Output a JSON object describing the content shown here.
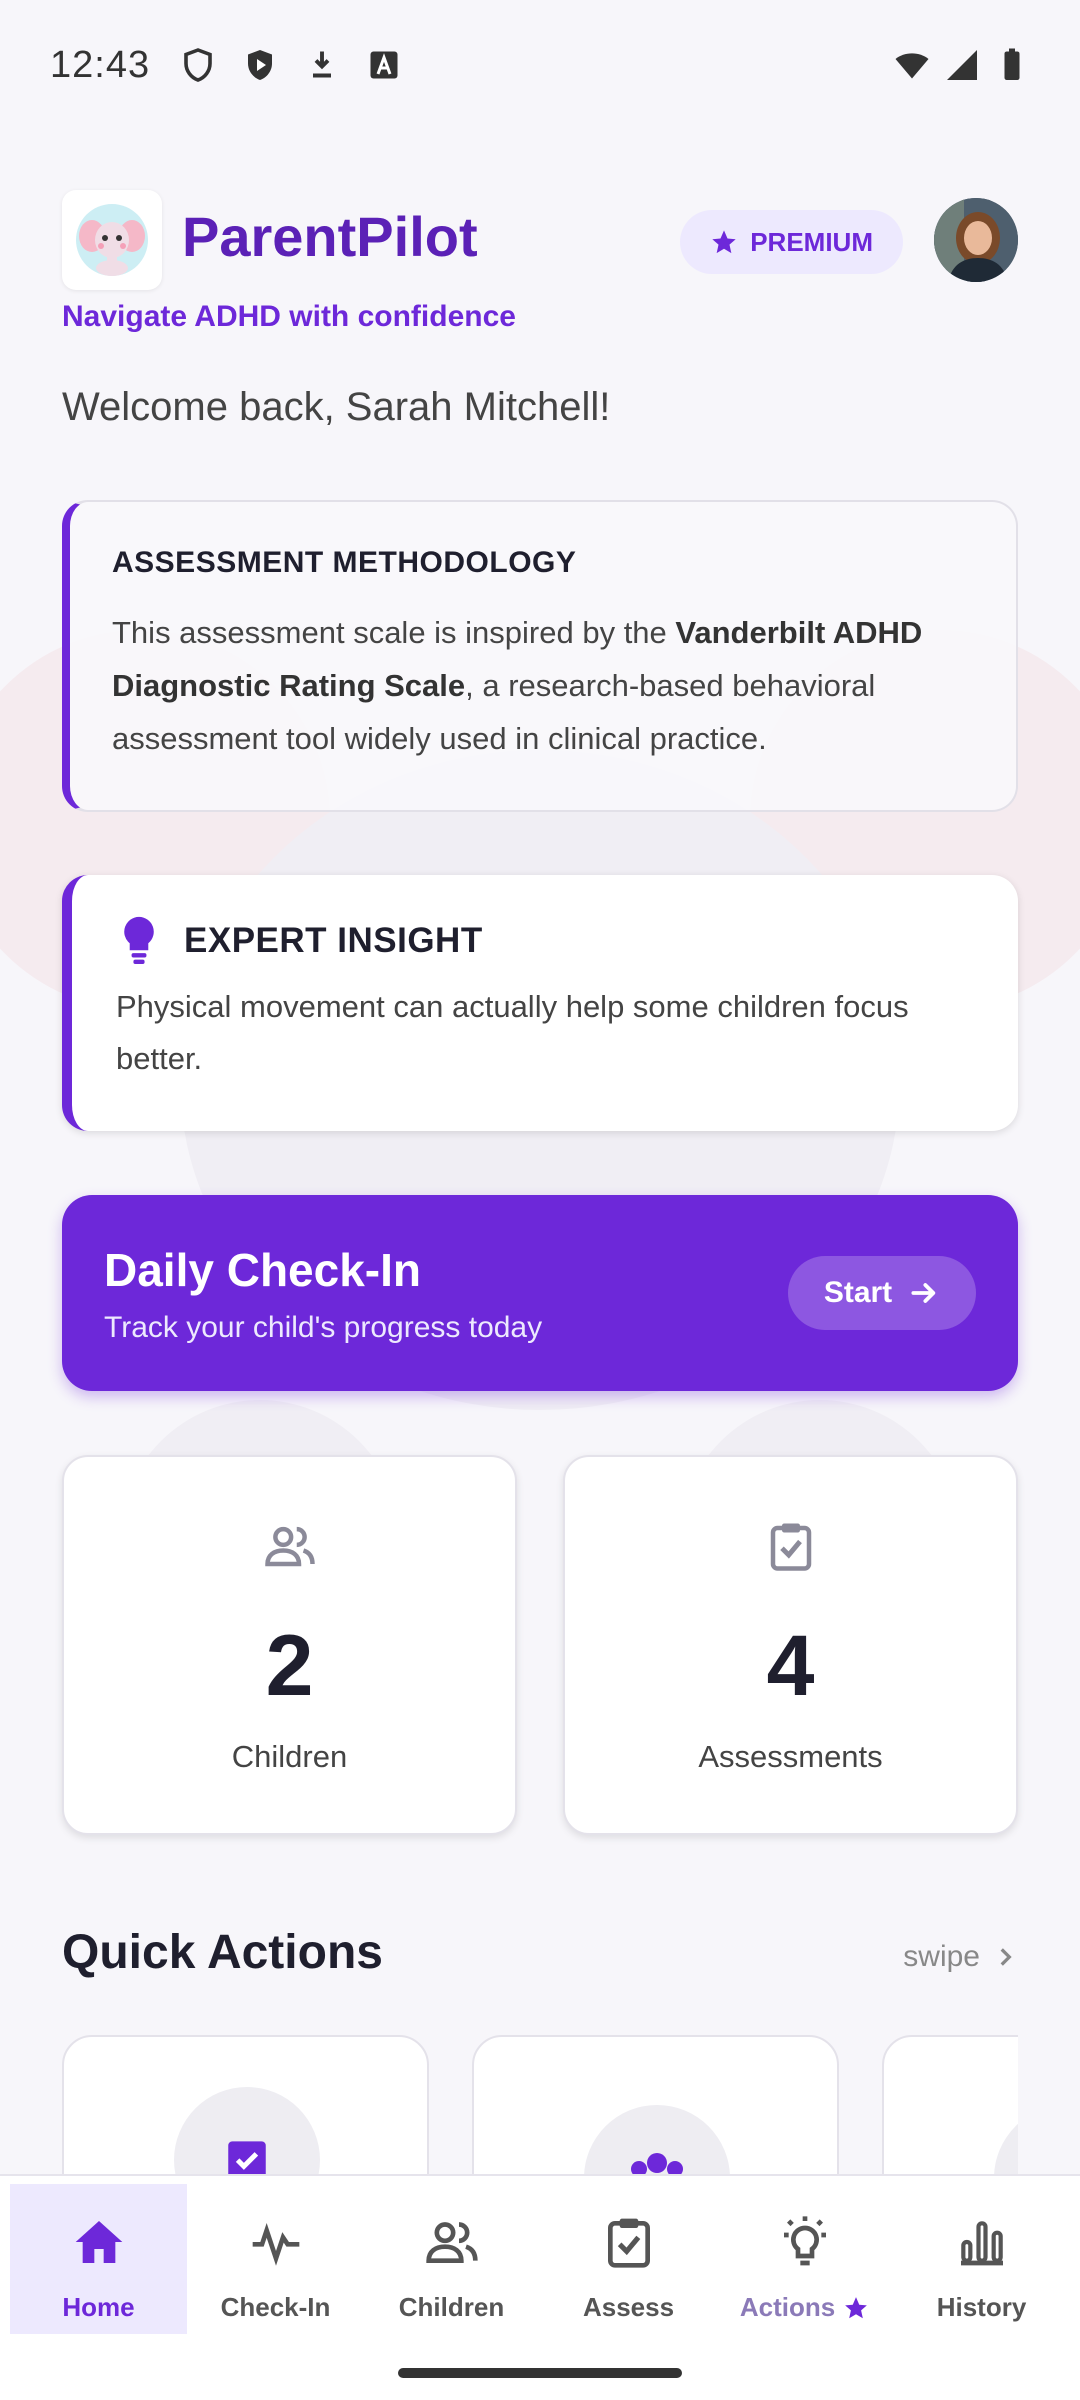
{
  "status_bar": {
    "time": "12:43"
  },
  "header": {
    "app_name": "ParentPilot",
    "tagline": "Navigate ADHD with confidence",
    "premium_label": "PREMIUM"
  },
  "welcome": "Welcome back, Sarah Mitchell!",
  "methodology": {
    "title": "ASSESSMENT METHODOLOGY",
    "text_before": "This assessment scale is inspired by the ",
    "text_bold": "Vanderbilt ADHD Diagnostic Rating Scale",
    "text_after": ", a research-based behavioral assessment tool widely used in clinical practice."
  },
  "insight": {
    "title": "EXPERT INSIGHT",
    "text": "Physical movement can actually help some children focus better."
  },
  "checkin": {
    "title": "Daily Check-In",
    "subtitle": "Track your child's progress today",
    "button": "Start"
  },
  "stats": [
    {
      "value": "2",
      "label": "Children",
      "icon": "people-icon"
    },
    {
      "value": "4",
      "label": "Assessments",
      "icon": "clipboard-check-icon"
    }
  ],
  "quick_actions": {
    "title": "Quick Actions",
    "swipe_hint": "swipe"
  },
  "nav": [
    {
      "label": "Home",
      "icon": "home-icon",
      "active": true
    },
    {
      "label": "Check-In",
      "icon": "pulse-icon"
    },
    {
      "label": "Children",
      "icon": "people-icon"
    },
    {
      "label": "Assess",
      "icon": "clipboard-check-icon"
    },
    {
      "label": "Actions",
      "icon": "lightbulb-icon",
      "premium": true
    },
    {
      "label": "History",
      "icon": "bar-chart-icon"
    }
  ],
  "colors": {
    "primary": "#6d28d9",
    "primary_light": "#ede9fe",
    "brand_text": "#5b21b6"
  }
}
